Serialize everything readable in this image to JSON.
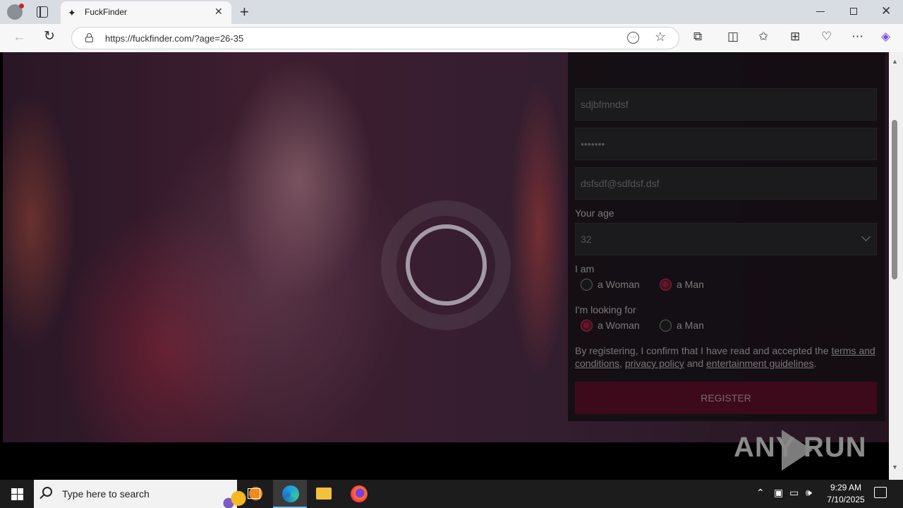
{
  "browser": {
    "tab_title": "FuckFinder",
    "url": "https://fuckfinder.com/?age=26-35",
    "newtab_symbol": "+",
    "close_symbol": "✕"
  },
  "form": {
    "username_value": "sdjbfmndsf",
    "password_value": "•••••••",
    "email_value": "dsfsdf@sdfdsf.dsf",
    "age_label": "Your age",
    "age_value": "32",
    "i_am_label": "I am",
    "i_am_options": [
      "a Woman",
      "a Man"
    ],
    "i_am_selected": "a Man",
    "looking_for_label": "I'm looking for",
    "looking_for_options": [
      "a Woman",
      "a Man"
    ],
    "looking_for_selected": "a Woman",
    "legal_prefix": "By registering, I confirm that I have read and accepted the ",
    "legal_link_terms": "terms and conditions",
    "legal_sep": ", ",
    "legal_link_privacy": "privacy policy",
    "legal_and": " and ",
    "legal_link_guidelines": "entertainment guidelines",
    "legal_suffix": ".",
    "register_label": "REGISTER"
  },
  "watermark": {
    "text": "ANY RUN"
  },
  "taskbar": {
    "search_placeholder": "Type here to search",
    "time": "9:29 AM",
    "date": "7/10/2025"
  },
  "colors": {
    "register_bg": "#3c0a1b",
    "radio_selected": "#6b1530",
    "accent_taskbar": "#76b9ed"
  }
}
